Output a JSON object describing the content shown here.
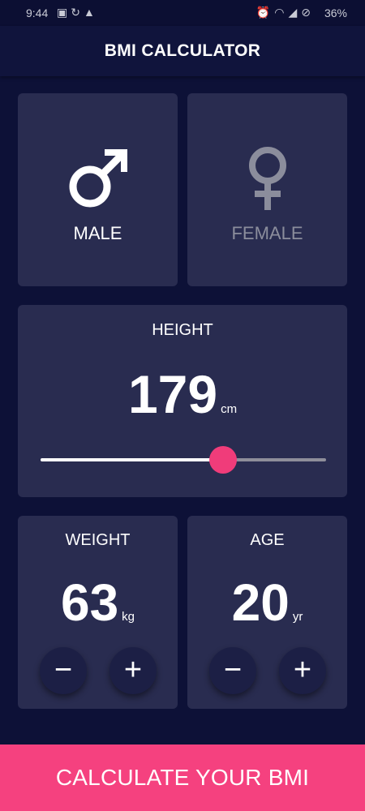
{
  "status_bar": {
    "time": "9:44",
    "battery": "36%",
    "left_icons": [
      "image-icon",
      "sync-icon",
      "warning-icon"
    ],
    "right_icons": [
      "alarm-icon",
      "wifi-icon",
      "signal-icon",
      "block-icon"
    ]
  },
  "app_bar": {
    "title": "BMI CALCULATOR"
  },
  "gender": {
    "male": {
      "label": "MALE",
      "icon": "male-icon",
      "selected": true
    },
    "female": {
      "label": "FEMALE",
      "icon": "female-icon",
      "selected": false
    }
  },
  "height": {
    "label": "HEIGHT",
    "value": "179",
    "unit": "cm",
    "slider_fraction": 0.64
  },
  "weight": {
    "label": "WEIGHT",
    "value": "63",
    "unit": "kg",
    "minus": "−",
    "plus": "+"
  },
  "age": {
    "label": "AGE",
    "value": "20",
    "unit": "yr",
    "minus": "−",
    "plus": "+"
  },
  "calculate": {
    "label": "CALCULATE YOUR BMI"
  },
  "colors": {
    "background": "#0d1137",
    "card": "#292c50",
    "accent": "#f5417f",
    "inactive": "#8b8d9c"
  }
}
